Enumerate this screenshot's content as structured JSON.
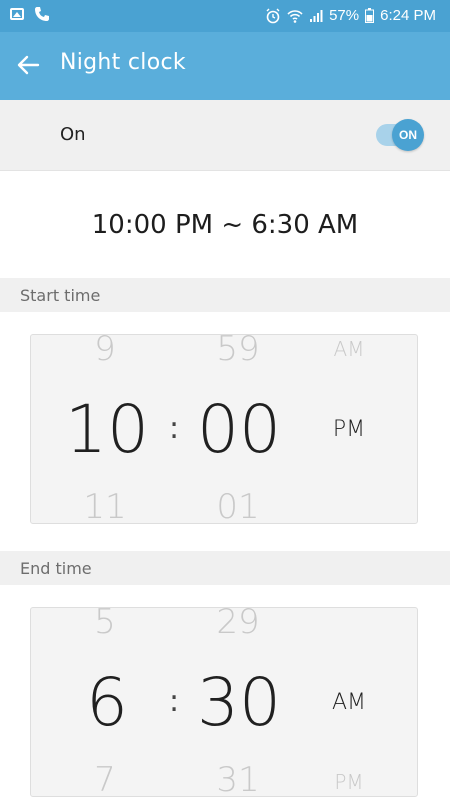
{
  "status_bar": {
    "icons_left": [
      "image-icon",
      "phone-icon"
    ],
    "icons_right": [
      "alarm-icon",
      "wifi-icon",
      "signal-icon"
    ],
    "battery": "57%",
    "time": "6:24 PM"
  },
  "app_bar": {
    "title": "Night clock"
  },
  "toggle_row": {
    "label": "On",
    "switch_label": "ON",
    "enabled": true
  },
  "summary": "10:00 PM ~ 6:30 AM",
  "start_time": {
    "header": "Start time",
    "hour_prev": "9",
    "minute_prev": "59",
    "period_prev": "AM",
    "hour": "10",
    "minute": "00",
    "period": "PM",
    "hour_next": "11",
    "minute_next": "01"
  },
  "end_time": {
    "header": "End time",
    "hour_prev": "5",
    "minute_prev": "29",
    "hour": "6",
    "minute": "30",
    "period": "AM",
    "hour_next": "7",
    "minute_next": "31",
    "period_next": "PM"
  },
  "colors": {
    "status_bar": "#4aa2d2",
    "app_bar": "#5aaedb",
    "toggle_on": "#4aa2d2"
  }
}
